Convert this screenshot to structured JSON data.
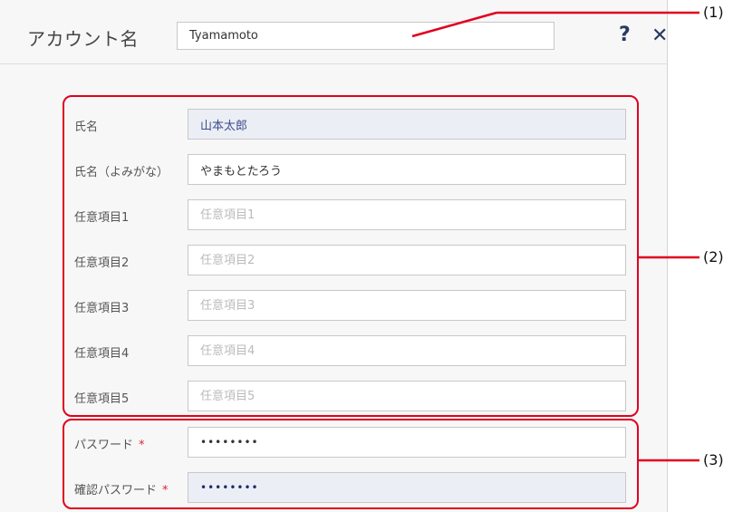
{
  "header": {
    "account_label": "アカウント名",
    "account_value": "Tyamamoto",
    "help_glyph": "?",
    "close_glyph": "✕"
  },
  "fields": [
    {
      "label": "氏名",
      "value": "山本太郎",
      "placeholder": ""
    },
    {
      "label": "氏名（よみがな）",
      "value": "やまもとたろう",
      "placeholder": ""
    },
    {
      "label": "任意項目1",
      "value": "",
      "placeholder": "任意項目1"
    },
    {
      "label": "任意項目2",
      "value": "",
      "placeholder": "任意項目2"
    },
    {
      "label": "任意項目3",
      "value": "",
      "placeholder": "任意項目3"
    },
    {
      "label": "任意項目4",
      "value": "",
      "placeholder": "任意項目4"
    },
    {
      "label": "任意項目5",
      "value": "",
      "placeholder": "任意項目5"
    }
  ],
  "password": {
    "label": "パスワード",
    "required_mark": "*",
    "value": "••••••••"
  },
  "confirm_password": {
    "label": "確認パスワード",
    "required_mark": "*",
    "value": "••••••••"
  },
  "callouts": {
    "c1": "(1)",
    "c2": "(2)",
    "c3": "(3)"
  },
  "colors": {
    "annotation": "#e1001f",
    "icon": "#2a3a5e",
    "readonly_bg": "#eceef5"
  }
}
